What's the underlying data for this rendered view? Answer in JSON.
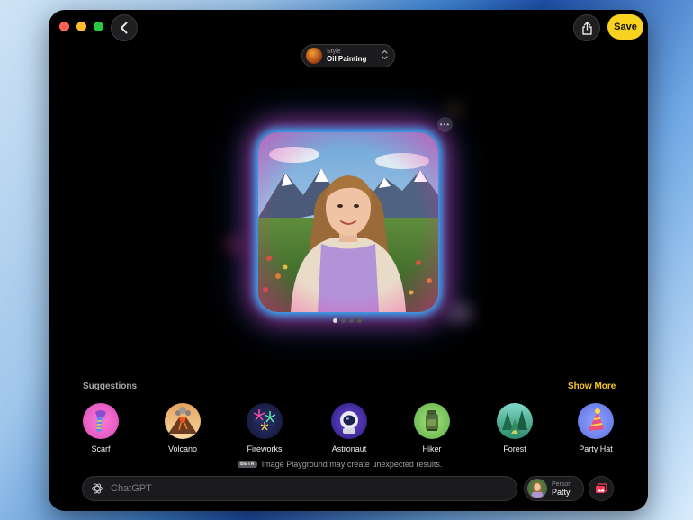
{
  "toolbar": {
    "back_icon": "chevron-left-icon",
    "share_icon": "share-icon",
    "save_label": "Save"
  },
  "style_picker": {
    "label": "Style",
    "value": "Oil Painting"
  },
  "preview": {
    "more_icon": "ellipsis-icon",
    "page_count": 4,
    "active_page": 1
  },
  "suggestions": {
    "title": "Suggestions",
    "show_more_label": "Show More",
    "items": [
      {
        "label": "Scarf",
        "icon": "scarf-icon"
      },
      {
        "label": "Volcano",
        "icon": "volcano-icon"
      },
      {
        "label": "Fireworks",
        "icon": "fireworks-icon"
      },
      {
        "label": "Astronaut",
        "icon": "astronaut-icon"
      },
      {
        "label": "Hiker",
        "icon": "hiker-icon"
      },
      {
        "label": "Forest",
        "icon": "forest-icon"
      },
      {
        "label": "Party Hat",
        "icon": "party-hat-icon"
      }
    ]
  },
  "disclaimer": {
    "badge": "BETA",
    "text": "Image Playground may create unexpected results."
  },
  "prompt": {
    "placeholder": "ChatGPT",
    "value": ""
  },
  "person": {
    "label": "Person",
    "name": "Patty"
  },
  "colors": {
    "accent": "#f7d21e",
    "link": "#f7c624",
    "glow_blue": "#2fb4ff",
    "glow_pink": "#ff28a0"
  }
}
